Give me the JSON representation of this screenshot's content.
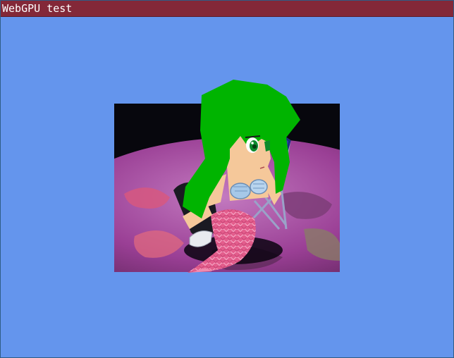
{
  "window": {
    "title": "WebGPU test"
  },
  "scene": {
    "clear_color": "#6495ed",
    "backdrop": "night-sky-with-planet",
    "model": "anime-mermaid-girl-on-folding-chair",
    "colors": {
      "hair": "#00b400",
      "skin": "#f5c89a",
      "tail": "#e8608e",
      "shell": "#a6c8e8",
      "planet": "#a04a9e",
      "sky": "#0a0a14"
    }
  }
}
